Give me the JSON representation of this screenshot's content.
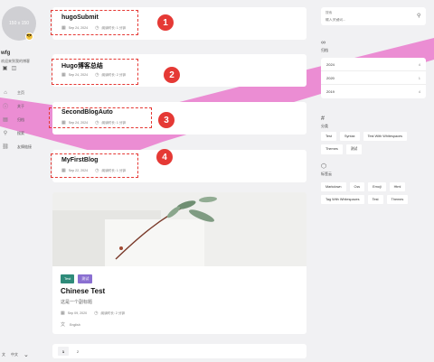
{
  "sidebar": {
    "avatar_text": "150 x 150",
    "avatar_badge": "😎",
    "site_name": "wfg",
    "site_desc": "欢迎来到我的博客",
    "menu": [
      {
        "icon": "home-icon",
        "glyph": "⌂",
        "label": "主页"
      },
      {
        "icon": "info-icon",
        "glyph": "ⓘ",
        "label": "关于"
      },
      {
        "icon": "archive-icon",
        "glyph": "▤",
        "label": "归档"
      },
      {
        "icon": "search-icon",
        "glyph": "⚲",
        "label": "搜索"
      },
      {
        "icon": "link-icon",
        "glyph": "⛓",
        "label": "友情链接"
      }
    ],
    "language": "中文",
    "translate_glyph": "文"
  },
  "articles": [
    {
      "title": "hugoSubmit",
      "date": "Sep 24, 2024",
      "read_time": "阅读时长: 1 分钟",
      "badge": "1"
    },
    {
      "title": "Hugo博客总结",
      "date": "Sep 24, 2024",
      "read_time": "阅读时长: 2 分钟",
      "badge": "2"
    },
    {
      "title": "SecondBlogAuto",
      "date": "Sep 24, 2024",
      "read_time": "阅读时长: 1 分钟",
      "badge": "3"
    },
    {
      "title": "MyFirstBlog",
      "date": "Sep 22, 2024",
      "read_time": "阅读时长: 1 分钟",
      "badge": "4"
    }
  ],
  "featured": {
    "tags": [
      {
        "label": "Test",
        "color": "#2e8b7a"
      },
      {
        "label": "测试",
        "color": "#8a6fd1"
      }
    ],
    "title": "Chinese Test",
    "subtitle": "这是一个副标题",
    "date": "Sep 09, 2020",
    "read_time": "阅读时长: 2 分钟",
    "language": "English"
  },
  "pagination": {
    "pages": [
      "1",
      "2"
    ],
    "active": "1"
  },
  "search": {
    "label": "搜索",
    "placeholder": "输入关键词..."
  },
  "archives": {
    "title": "归档",
    "rows": [
      {
        "year": "2024",
        "count": "4"
      },
      {
        "year": "2020",
        "count": "1"
      },
      {
        "year": "2019",
        "count": "4"
      }
    ]
  },
  "categories": {
    "title": "分类",
    "items": [
      "Test",
      "Syntax",
      "Test With Whitespaces",
      "Themes",
      "测试"
    ]
  },
  "tags_widget": {
    "title": "标签云",
    "items": [
      "Markdown",
      "Css",
      "Emoji",
      "Html",
      "Tag With Whitespaces",
      "Test",
      "Themes"
    ]
  },
  "colors": {
    "accent_red": "#e53935",
    "highlight_pink": "#e86bc8"
  }
}
